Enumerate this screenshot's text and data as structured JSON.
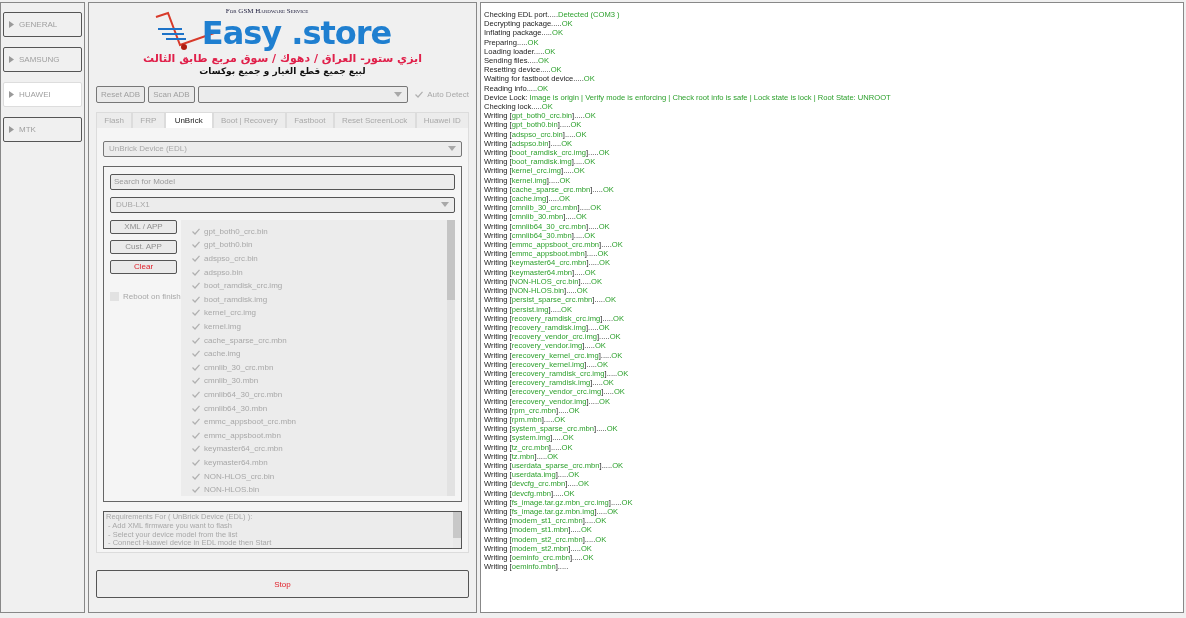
{
  "sidebar": {
    "items": [
      {
        "label": "GENERAL",
        "selected": false
      },
      {
        "label": "SAMSUNG",
        "selected": false
      },
      {
        "label": "HUAWEI",
        "selected": true
      },
      {
        "label": "MTK",
        "selected": false
      }
    ]
  },
  "logo": {
    "tagline": "For GSM Hardware Service",
    "brand_left": "Easy",
    "brand_right": ".store",
    "arabic_line": "ايزي ستور- العراق / دهوك / سوق مربع طابق الثالث",
    "arabic_subline": "لبيع جميع قطع الغيار و جميع بوكسات"
  },
  "toolbar": {
    "buttons": [
      "Reset ADB",
      "Scan ADB"
    ],
    "auto_detect": {
      "label": "Auto Detect",
      "checked": true
    }
  },
  "tabs": [
    {
      "label": "Flash",
      "selected": false
    },
    {
      "label": "FRP",
      "selected": false
    },
    {
      "label": "UnBrick",
      "selected": true
    },
    {
      "label": "Boot | Recovery",
      "selected": false
    },
    {
      "label": "Fastboot",
      "selected": false
    },
    {
      "label": "Reset ScreenLock",
      "selected": false
    },
    {
      "label": "Huawei ID",
      "selected": false
    }
  ],
  "unbrick": {
    "mode_select": {
      "value": "UnBrick Device (EDL)"
    },
    "search": {
      "placeholder": "Search for Model"
    },
    "model_select": {
      "value": "DUB-LX1"
    },
    "buttons": [
      {
        "label": "XML / APP",
        "kind": "normal"
      },
      {
        "label": "Cust. APP",
        "kind": "normal"
      },
      {
        "label": "Clear",
        "kind": "danger"
      }
    ],
    "reboot_on_finish": {
      "label": "Reboot on finish",
      "checked": false
    },
    "files": [
      {
        "name": "gpt_both0_crc.bin",
        "checked": true
      },
      {
        "name": "gpt_both0.bin",
        "checked": true
      },
      {
        "name": "adspso_crc.bin",
        "checked": true
      },
      {
        "name": "adspso.bin",
        "checked": true
      },
      {
        "name": "boot_ramdisk_crc.img",
        "checked": true
      },
      {
        "name": "boot_ramdisk.img",
        "checked": true
      },
      {
        "name": "kernel_crc.img",
        "checked": true
      },
      {
        "name": "kernel.img",
        "checked": true
      },
      {
        "name": "cache_sparse_crc.mbn",
        "checked": true
      },
      {
        "name": "cache.img",
        "checked": true
      },
      {
        "name": "cmnlib_30_crc.mbn",
        "checked": true
      },
      {
        "name": "cmnlib_30.mbn",
        "checked": true
      },
      {
        "name": "cmnlib64_30_crc.mbn",
        "checked": true
      },
      {
        "name": "cmnlib64_30.mbn",
        "checked": true
      },
      {
        "name": "emmc_appsboot_crc.mbn",
        "checked": true
      },
      {
        "name": "emmc_appsboot.mbn",
        "checked": true
      },
      {
        "name": "keymaster64_crc.mbn",
        "checked": true
      },
      {
        "name": "keymaster64.mbn",
        "checked": true
      },
      {
        "name": "NON-HLOS_crc.bin",
        "checked": true
      },
      {
        "name": "NON-HLOS.bin",
        "checked": true
      }
    ],
    "requirements": [
      "Requirements For ( UnBrick Device (EDL) ):",
      " - Add XML firmware you want to flash",
      " - Select your device model from the list",
      " - Connect Huawei device in EDL mode then Start"
    ]
  },
  "stop_button": "Stop",
  "log": [
    {
      "lead": "Checking EDL port.....",
      "result": "Detected (COM3 )"
    },
    {
      "lead": "Decrypting package.....",
      "result": "OK"
    },
    {
      "lead": "Inflating package.....",
      "result": "OK"
    },
    {
      "lead": "Preparing.....",
      "result": "OK"
    },
    {
      "lead": "Loading loader.....",
      "result": "OK"
    },
    {
      "lead": "Sending files.....",
      "result": "OK"
    },
    {
      "lead": "Resetting device.....",
      "result": "OK"
    },
    {
      "lead": "Waiting for fastboot device.....",
      "result": "OK"
    },
    {
      "lead": "Reading info.....",
      "result": "OK"
    },
    {
      "lead": "Device Lock: ",
      "result": "Image is origin | Verify mode is enforcing | Check root info is safe | Lock state is lock | Root State: UNROOT"
    },
    {
      "lead": "Checking lock.....",
      "result": "OK"
    },
    {
      "lead": "Writing [",
      "item": "gpt_both0_crc.bin",
      "tail": "].....",
      "result": "OK"
    },
    {
      "lead": "Writing [",
      "item": "gpt_both0.bin",
      "tail": "].....",
      "result": "OK"
    },
    {
      "lead": "Writing [",
      "item": "adspso_crc.bin",
      "tail": "].....",
      "result": "OK"
    },
    {
      "lead": "Writing [",
      "item": "adspso.bin",
      "tail": "].....",
      "result": "OK"
    },
    {
      "lead": "Writing [",
      "item": "boot_ramdisk_crc.img",
      "tail": "].....",
      "result": "OK"
    },
    {
      "lead": "Writing [",
      "item": "boot_ramdisk.img",
      "tail": "].....",
      "result": "OK"
    },
    {
      "lead": "Writing [",
      "item": "kernel_crc.img",
      "tail": "].....",
      "result": "OK"
    },
    {
      "lead": "Writing [",
      "item": "kernel.img",
      "tail": "].....",
      "result": "OK"
    },
    {
      "lead": "Writing [",
      "item": "cache_sparse_crc.mbn",
      "tail": "].....",
      "result": "OK"
    },
    {
      "lead": "Writing [",
      "item": "cache.img",
      "tail": "].....",
      "result": "OK"
    },
    {
      "lead": "Writing [",
      "item": "cmnlib_30_crc.mbn",
      "tail": "].....",
      "result": "OK"
    },
    {
      "lead": "Writing [",
      "item": "cmnlib_30.mbn",
      "tail": "].....",
      "result": "OK"
    },
    {
      "lead": "Writing [",
      "item": "cmnlib64_30_crc.mbn",
      "tail": "].....",
      "result": "OK"
    },
    {
      "lead": "Writing [",
      "item": "cmnlib64_30.mbn",
      "tail": "].....",
      "result": "OK"
    },
    {
      "lead": "Writing [",
      "item": "emmc_appsboot_crc.mbn",
      "tail": "].....",
      "result": "OK"
    },
    {
      "lead": "Writing [",
      "item": "emmc_appsboot.mbn",
      "tail": "].....",
      "result": "OK"
    },
    {
      "lead": "Writing [",
      "item": "keymaster64_crc.mbn",
      "tail": "].....",
      "result": "OK"
    },
    {
      "lead": "Writing [",
      "item": "keymaster64.mbn",
      "tail": "].....",
      "result": "OK"
    },
    {
      "lead": "Writing [",
      "item": "NON-HLOS_crc.bin",
      "tail": "].....",
      "result": "OK"
    },
    {
      "lead": "Writing [",
      "item": "NON-HLOS.bin",
      "tail": "].....",
      "result": "OK"
    },
    {
      "lead": "Writing [",
      "item": "persist_sparse_crc.mbn",
      "tail": "].....",
      "result": "OK"
    },
    {
      "lead": "Writing [",
      "item": "persist.img",
      "tail": "].....",
      "result": "OK"
    },
    {
      "lead": "Writing [",
      "item": "recovery_ramdisk_crc.img",
      "tail": "].....",
      "result": "OK"
    },
    {
      "lead": "Writing [",
      "item": "recovery_ramdisk.img",
      "tail": "].....",
      "result": "OK"
    },
    {
      "lead": "Writing [",
      "item": "recovery_vendor_crc.img",
      "tail": "].....",
      "result": "OK"
    },
    {
      "lead": "Writing [",
      "item": "recovery_vendor.img",
      "tail": "].....",
      "result": "OK"
    },
    {
      "lead": "Writing [",
      "item": "erecovery_kernel_crc.img",
      "tail": "].....",
      "result": "OK"
    },
    {
      "lead": "Writing [",
      "item": "erecovery_kernel.img",
      "tail": "].....",
      "result": "OK"
    },
    {
      "lead": "Writing [",
      "item": "erecovery_ramdisk_crc.img",
      "tail": "].....",
      "result": "OK"
    },
    {
      "lead": "Writing [",
      "item": "erecovery_ramdisk.img",
      "tail": "].....",
      "result": "OK"
    },
    {
      "lead": "Writing [",
      "item": "erecovery_vendor_crc.img",
      "tail": "].....",
      "result": "OK"
    },
    {
      "lead": "Writing [",
      "item": "erecovery_vendor.img",
      "tail": "].....",
      "result": "OK"
    },
    {
      "lead": "Writing [",
      "item": "rpm_crc.mbn",
      "tail": "].....",
      "result": "OK"
    },
    {
      "lead": "Writing [",
      "item": "rpm.mbn",
      "tail": "].....",
      "result": "OK"
    },
    {
      "lead": "Writing [",
      "item": "system_sparse_crc.mbn",
      "tail": "].....",
      "result": "OK"
    },
    {
      "lead": "Writing [",
      "item": "system.img",
      "tail": "].....",
      "result": "OK"
    },
    {
      "lead": "Writing [",
      "item": "tz_crc.mbn",
      "tail": "].....",
      "result": "OK"
    },
    {
      "lead": "Writing [",
      "item": "tz.mbn",
      "tail": "].....",
      "result": "OK"
    },
    {
      "lead": "Writing [",
      "item": "userdata_sparse_crc.mbn",
      "tail": "].....",
      "result": "OK"
    },
    {
      "lead": "Writing [",
      "item": "userdata.img",
      "tail": "].....",
      "result": "OK"
    },
    {
      "lead": "Writing [",
      "item": "devcfg_crc.mbn",
      "tail": "].....",
      "result": "OK"
    },
    {
      "lead": "Writing [",
      "item": "devcfg.mbn",
      "tail": "].....",
      "result": "OK"
    },
    {
      "lead": "Writing [",
      "item": "fs_image.tar.gz.mbn_crc.img",
      "tail": "].....",
      "result": "OK"
    },
    {
      "lead": "Writing [",
      "item": "fs_image.tar.gz.mbn.img",
      "tail": "].....",
      "result": "OK"
    },
    {
      "lead": "Writing [",
      "item": "modem_st1_crc.mbn",
      "tail": "].....",
      "result": "OK"
    },
    {
      "lead": "Writing [",
      "item": "modem_st1.mbn",
      "tail": "].....",
      "result": "OK"
    },
    {
      "lead": "Writing [",
      "item": "modem_st2_crc.mbn",
      "tail": "].....",
      "result": "OK"
    },
    {
      "lead": "Writing [",
      "item": "modem_st2.mbn",
      "tail": "].....",
      "result": "OK"
    },
    {
      "lead": "Writing [",
      "item": "oeminfo_crc.mbn",
      "tail": "].....",
      "result": "OK"
    },
    {
      "lead": "Writing [",
      "item": "oeminfo.mbn",
      "tail": "]....."
    }
  ]
}
